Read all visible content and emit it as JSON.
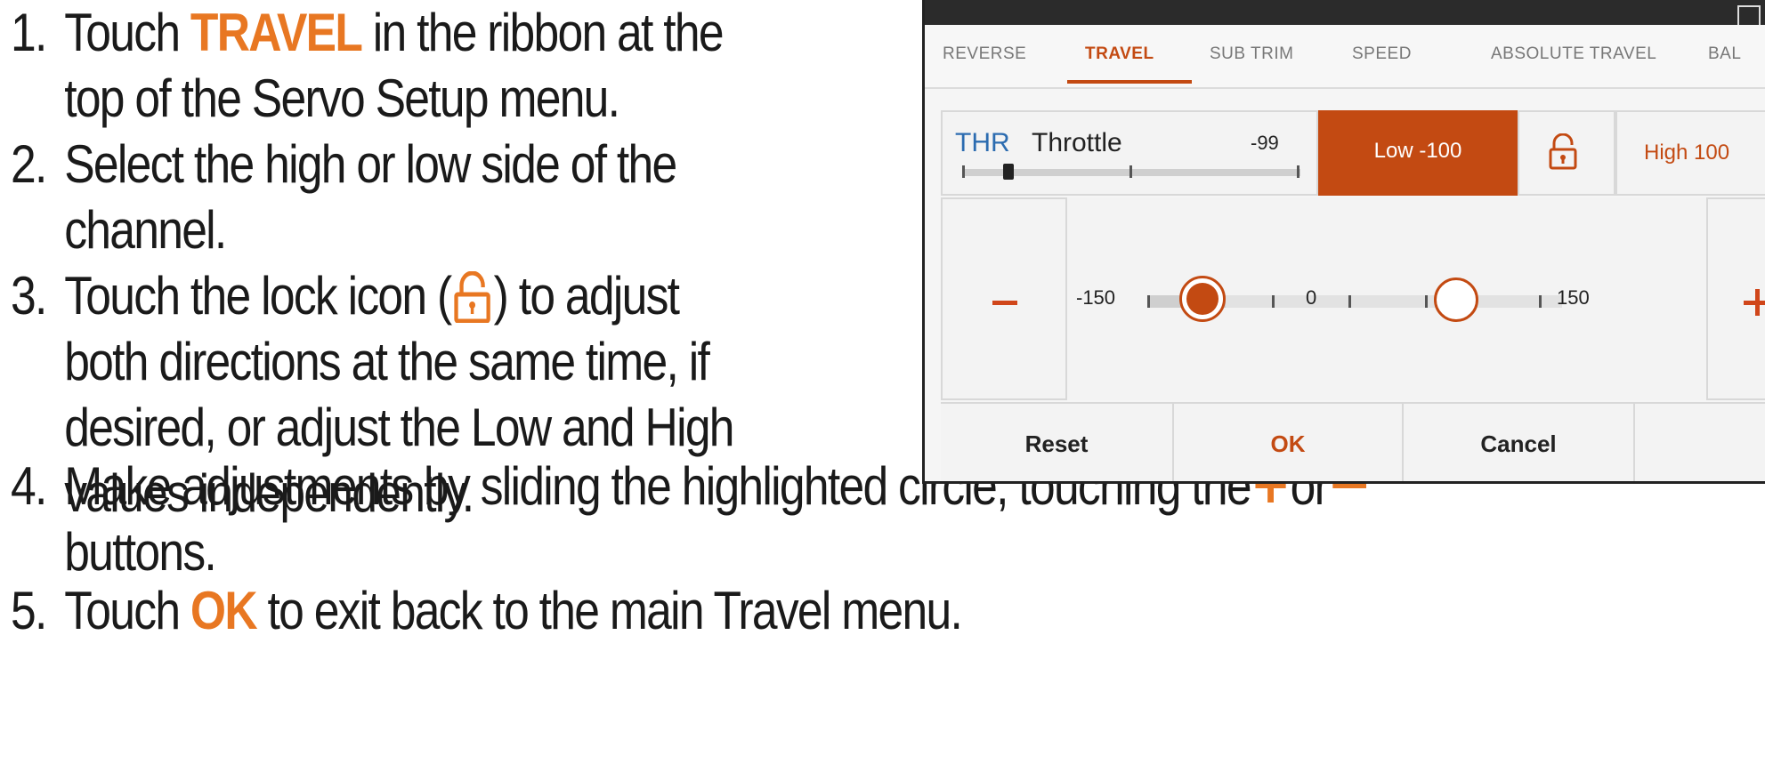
{
  "steps": [
    {
      "num": "1.",
      "pre": "Touch ",
      "hl": "TRAVEL",
      "post": " in the ribbon at the",
      "cont": "top of the Servo Setup menu."
    },
    {
      "num": "2.",
      "text": "Select the high or low side of the",
      "cont": "channel."
    },
    {
      "num": "3.",
      "pre": "Touch the lock icon (",
      "post": ") to adjust",
      "cont": [
        "both directions at the same time, if",
        "desired, or adjust the Low and High",
        "values independently."
      ]
    },
    {
      "num": "4.",
      "pre": "Make adjustments by sliding the highlighted circle, touching the",
      "mid": "or",
      "cont": "buttons."
    },
    {
      "num": "5.",
      "pre": "Touch ",
      "hl": "OK",
      "post": " to exit back to the main Travel menu."
    }
  ],
  "screen": {
    "tabs": [
      "REVERSE",
      "TRAVEL",
      "SUB TRIM",
      "SPEED",
      "ABSOLUTE TRAVEL",
      "BAL"
    ],
    "active_tab": "TRAVEL",
    "channel_code": "THR",
    "channel_name": "Throttle",
    "channel_value": "-99",
    "low_label": "Low -100",
    "high_label": "High 100",
    "slider_min": "-150",
    "slider_mid": "0",
    "slider_max": "150",
    "low_value": -100,
    "high_value": 100,
    "footer": {
      "reset": "Reset",
      "ok": "OK",
      "cancel": "Cancel"
    }
  },
  "icons": {
    "lock": "unlocked-padlock-icon",
    "plus": "plus-icon",
    "minus": "minus-icon"
  },
  "colors": {
    "accent": "#e87722",
    "active": "#c34a12",
    "channel_code": "#2c6cb0"
  }
}
